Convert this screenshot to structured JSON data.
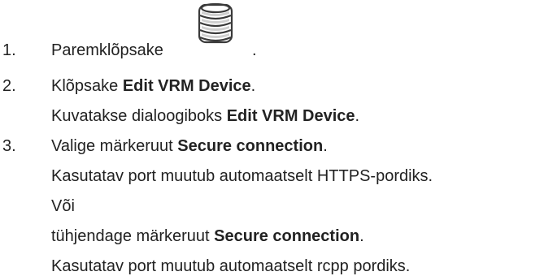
{
  "steps": [
    {
      "number": "1.",
      "text": "Paremklõpsake",
      "icon": "vrm-database-icon",
      "after_icon": "."
    },
    {
      "number": "2.",
      "text_before": "Klõpsake ",
      "bold": "Edit VRM Device",
      "text_after": ".",
      "result_before": "Kuvatakse dialoogiboks ",
      "result_bold": "Edit VRM Device",
      "result_after": "."
    },
    {
      "number": "3.",
      "text_before": "Valige märkeruut ",
      "bold": "Secure connection",
      "text_after": ".",
      "result1": "Kasutatav port muutub automaatselt HTTPS-pordiks.",
      "or": "Või",
      "alt_before": "tühjendage märkeruut ",
      "alt_bold": "Secure connection",
      "alt_after": ".",
      "result2": "Kasutatav port muutub automaatselt rcpp pordiks."
    }
  ]
}
